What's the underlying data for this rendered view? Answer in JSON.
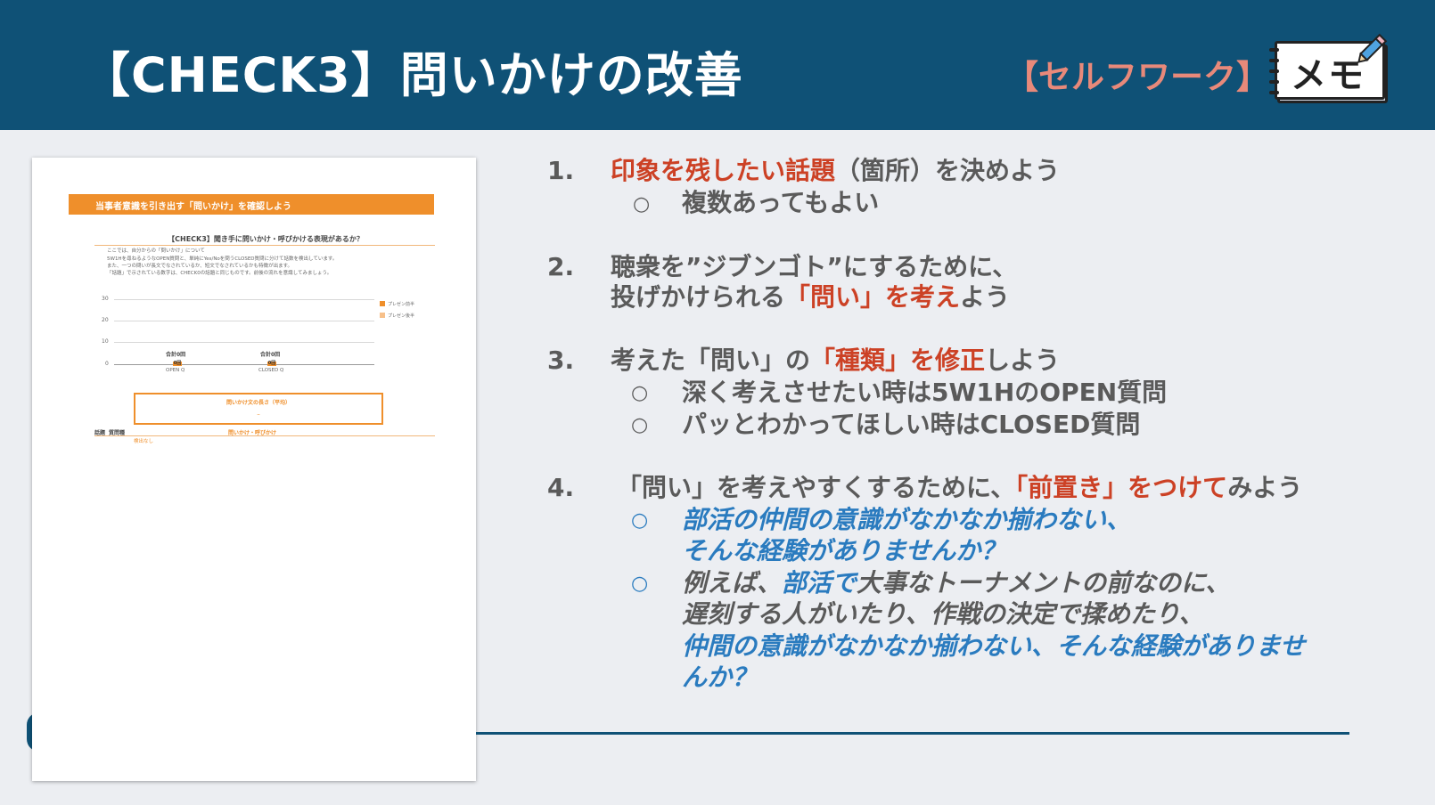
{
  "header": {
    "title": "【CHECK3】問いかけの改善",
    "selfwork_label": "【セルフワーク】",
    "memo_text": "メモ",
    "bg_color": "#0f5176"
  },
  "document_thumbnail": {
    "banner": "当事者意識を引き出す「問いかけ」を確認しよう",
    "question": "【CHECK3】聞き手に問いかけ・呼びかける表現があるか？",
    "desc_lines": [
      "ここでは、自分からの「問いかけ」について",
      "5W1Hを尋ねるようなOPEN質問と、単純にYes/Noを問うCLOSED質問に分けて話数を検出しています。",
      "また、一つの問いが長文でなされているか、短文でなされているかも特徴が出ます。",
      "「話題」で示されている数字は、CHECK0の話題と同じものです。前後の流れを意識してみましょう。"
    ],
    "chart": {
      "y_ticks": [
        "30",
        "20",
        "10",
        "0"
      ],
      "legend": [
        "プレゼン前半",
        "プレゼン後半"
      ],
      "categories": [
        {
          "title": "合計0回",
          "label": "OPEN Q",
          "value": "0回"
        },
        {
          "title": "合計0回",
          "label": "CLOSED Q",
          "value": "0回"
        }
      ]
    },
    "avg_box": {
      "title": "問いかけ文の長さ（平均）",
      "value": "–"
    },
    "table": {
      "col_topic": "話題",
      "col_type": "質問種",
      "col_question": "問いかけ・呼びかけ",
      "empty_text": "検出なし"
    }
  },
  "items": [
    {
      "number": "1.",
      "lines": [
        [
          {
            "t": "印象を残したい話題",
            "s": "red"
          },
          {
            "t": "（箇所）を決めよう",
            "s": ""
          }
        ]
      ],
      "sub": [
        {
          "lines": [
            [
              {
                "t": "複数あってもよい",
                "s": ""
              }
            ]
          ]
        }
      ]
    },
    {
      "number": "2.",
      "lines": [
        [
          {
            "t": "聴衆を”ジブンゴト”にするために、",
            "s": ""
          }
        ],
        [
          {
            "t": "投げかけられる",
            "s": ""
          },
          {
            "t": "「問い」を考え",
            "s": "red"
          },
          {
            "t": "よう",
            "s": ""
          }
        ]
      ],
      "sub": []
    },
    {
      "number": "3.",
      "lines": [
        [
          {
            "t": "考えた「問い」の",
            "s": ""
          },
          {
            "t": "「種類」を修正",
            "s": "red"
          },
          {
            "t": "しよう",
            "s": ""
          }
        ]
      ],
      "sub": [
        {
          "lines": [
            [
              {
                "t": "深く考えさせたい時は5W1HのOPEN質問",
                "s": ""
              }
            ]
          ]
        },
        {
          "lines": [
            [
              {
                "t": "パッとわかってほしい時はCLOSED質問",
                "s": ""
              }
            ]
          ]
        }
      ]
    },
    {
      "number": "4.",
      "lines": [
        [
          {
            "t": "「問い」を考えやすくするために、",
            "s": ""
          },
          {
            "t": "「前置き」をつけて",
            "s": "red"
          },
          {
            "t": "みよう",
            "s": ""
          }
        ]
      ],
      "sub": [
        {
          "lines": [
            [
              {
                "t": "部活の仲間の意識がなかなか揃わない、",
                "s": "blue-it"
              }
            ],
            [
              {
                "t": "そんな経験がありませんか？",
                "s": "blue-it"
              }
            ]
          ]
        },
        {
          "lines": [
            [
              {
                "t": "例えば、",
                "s": "gray-it"
              },
              {
                "t": "部活で",
                "s": "blue-it"
              },
              {
                "t": "大事なトーナメントの前なのに、",
                "s": "gray-it"
              }
            ],
            [
              {
                "t": "遅刻する人がいたり、作戦の決定で揉めたり、",
                "s": "gray-it"
              }
            ],
            [
              {
                "t": "仲間の意識がなかなか揃わない、そんな経験がありませ",
                "s": "blue-it"
              }
            ],
            [
              {
                "t": "んか？",
                "s": "blue-it"
              }
            ]
          ]
        }
      ]
    }
  ],
  "bullet_char": "○",
  "colors": {
    "accent_red": "#cc4125",
    "accent_blue": "#2a7bbf",
    "orange": "#ef8f2b"
  }
}
